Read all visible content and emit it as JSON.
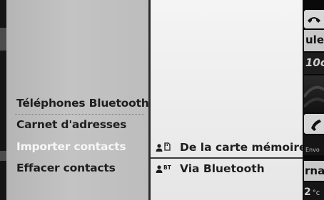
{
  "menu": {
    "items": [
      {
        "label": "Téléphones Bluetooth",
        "state": "normal"
      },
      {
        "label": "Carnet d'adresses",
        "state": "normal"
      },
      {
        "label": "Importer contacts",
        "state": "selected"
      },
      {
        "label": "Effacer contacts",
        "state": "normal"
      }
    ]
  },
  "submenu": {
    "items": [
      {
        "icon": "memory-card-contact-icon",
        "label": "De la carte mémoire",
        "state": "highlighted"
      },
      {
        "icon": "bluetooth-contact-icon",
        "label": "Via Bluetooth",
        "state": "normal"
      }
    ]
  },
  "right_strip": {
    "text_1": "ule",
    "text_2": "10c",
    "text_3": "Envo",
    "text_4": "rnal",
    "text_5": "2",
    "text_5_unit": "°c"
  },
  "colors": {
    "menu_bg": "#bdbdbd",
    "menu_text": "#1e1e1e",
    "menu_selected_text": "#f6f6f6",
    "submenu_bg": "#ececec",
    "screen_bg": "#0d0d0d"
  }
}
